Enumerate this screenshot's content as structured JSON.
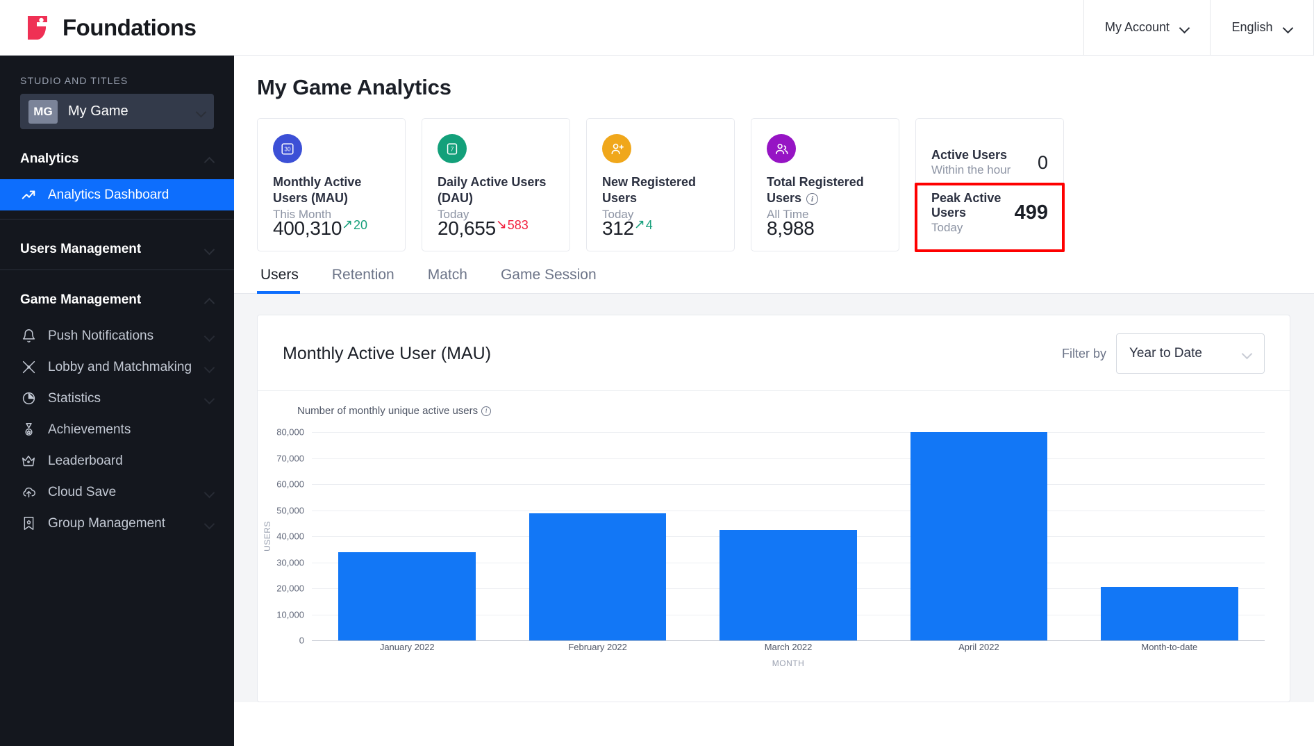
{
  "header": {
    "brand": "Foundations",
    "account_label": "My Account",
    "language_label": "English"
  },
  "sidebar": {
    "section_label": "STUDIO AND TITLES",
    "title_badge": "MG",
    "title_name": "My Game",
    "groups": [
      {
        "label": "Analytics",
        "expanded": true
      },
      {
        "label": "Users Management",
        "expanded": false
      },
      {
        "label": "Game Management",
        "expanded": true
      }
    ],
    "analytics_items": [
      {
        "label": "Analytics Dashboard",
        "icon": "trending-up-icon",
        "active": true
      }
    ],
    "game_items": [
      {
        "label": "Push Notifications",
        "icon": "bell-icon",
        "chevron": true
      },
      {
        "label": "Lobby and Matchmaking",
        "icon": "swords-icon",
        "chevron": true
      },
      {
        "label": "Statistics",
        "icon": "pie-chart-icon",
        "chevron": true
      },
      {
        "label": "Achievements",
        "icon": "medal-icon",
        "chevron": false
      },
      {
        "label": "Leaderboard",
        "icon": "crown-icon",
        "chevron": false
      },
      {
        "label": "Cloud Save",
        "icon": "cloud-upload-icon",
        "chevron": true
      },
      {
        "label": "Group Management",
        "icon": "banner-icon",
        "chevron": true
      }
    ]
  },
  "main": {
    "page_title": "My Game Analytics",
    "kpi_cards": [
      {
        "icon": "calendar-30-icon",
        "icon_color": "#3c50d6",
        "label": "Monthly Active Users (MAU)",
        "period": "This Month",
        "value": "400,310",
        "delta": "20",
        "delta_dir": "up",
        "delta_arrow": "↗"
      },
      {
        "icon": "calendar-7-icon",
        "icon_color": "#13a07a",
        "label": "Daily Active Users (DAU)",
        "period": "Today",
        "value": "20,655",
        "delta": "583",
        "delta_dir": "down",
        "delta_arrow": "↘"
      },
      {
        "icon": "user-plus-icon",
        "icon_color": "#f0a71b",
        "label": "New Registered Users",
        "period": "Today",
        "value": "312",
        "delta": "4",
        "delta_dir": "up",
        "delta_arrow": "↗"
      },
      {
        "icon": "users-icon",
        "icon_color": "#9614c4",
        "label": "Total Registered Users",
        "label_has_info": true,
        "period": "All Time",
        "value": "8,988",
        "delta": "",
        "delta_dir": "none",
        "delta_arrow": ""
      }
    ],
    "active_users_card": {
      "rows": [
        {
          "title": "Active Users",
          "sub": "Within the hour",
          "value": "0",
          "highlighted": false
        },
        {
          "title": "Peak Active Users",
          "sub": "Today",
          "value": "499",
          "highlighted": true
        }
      ],
      "highlight_color": "#fe0000"
    },
    "tabs": [
      {
        "label": "Users",
        "active": true
      },
      {
        "label": "Retention",
        "active": false
      },
      {
        "label": "Match",
        "active": false
      },
      {
        "label": "Game Session",
        "active": false
      }
    ],
    "panel": {
      "title": "Monthly Active User (MAU)",
      "filter_label": "Filter by",
      "filter_value": "Year to Date"
    }
  },
  "chart_data": {
    "type": "bar",
    "title": "Monthly Active User (MAU)",
    "caption": "Number of monthly unique active users",
    "categories": [
      "January 2022",
      "February 2022",
      "March 2022",
      "April 2022",
      "Month-to-date"
    ],
    "values": [
      34000,
      48800,
      42300,
      80000,
      20600
    ],
    "xlabel": "MONTH",
    "ylabel": "USERS",
    "ylim": [
      0,
      80000
    ],
    "yticks": [
      0,
      10000,
      20000,
      30000,
      40000,
      50000,
      60000,
      70000,
      80000
    ],
    "ytick_labels": [
      "0",
      "10,000",
      "20,000",
      "30,000",
      "40,000",
      "50,000",
      "60,000",
      "70,000",
      "80,000"
    ],
    "grid": true,
    "legend": false,
    "bar_color": "#1277f6"
  }
}
